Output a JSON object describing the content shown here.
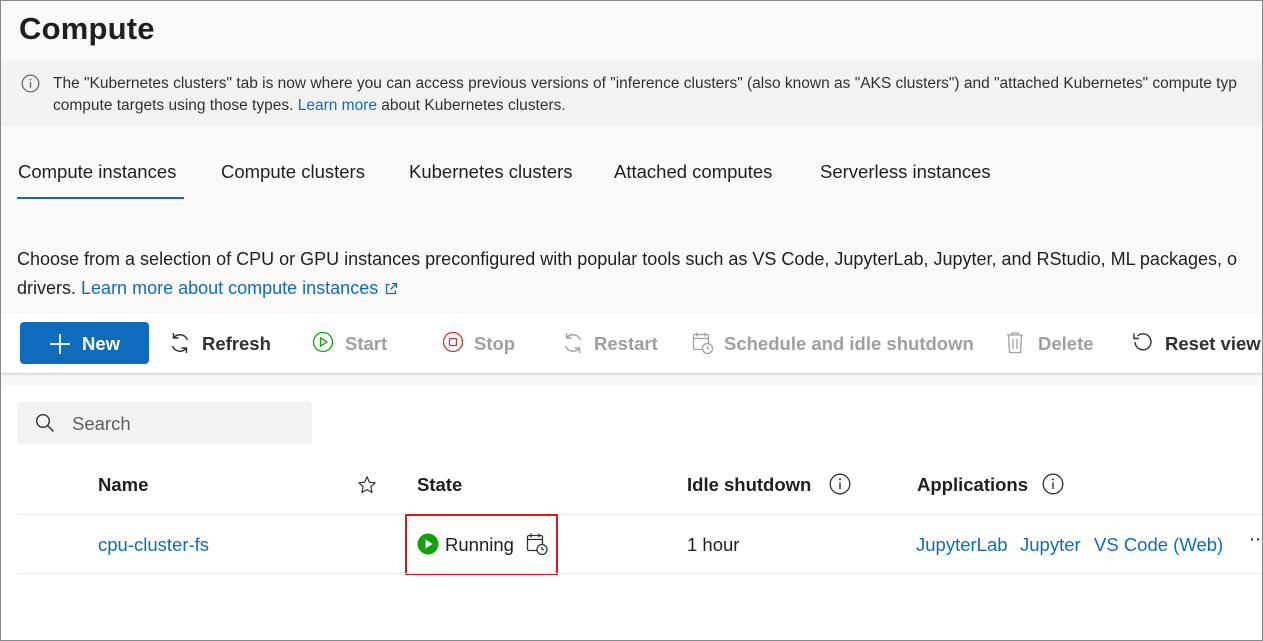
{
  "page": {
    "title": "Compute"
  },
  "info_bar": {
    "line1": "The \"Kubernetes clusters\" tab is now where you can access previous versions of \"inference clusters\" (also known as \"AKS clusters\") and \"attached Kubernetes\" compute typ",
    "line2_before": "compute targets using those types.",
    "link": "Learn more",
    "line2_after": "about Kubernetes clusters."
  },
  "tabs": [
    {
      "label": "Compute instances",
      "active": true
    },
    {
      "label": "Compute clusters",
      "active": false
    },
    {
      "label": "Kubernetes clusters",
      "active": false
    },
    {
      "label": "Attached computes",
      "active": false
    },
    {
      "label": "Serverless instances",
      "active": false
    }
  ],
  "description": {
    "line1": "Choose from a selection of CPU or GPU instances preconfigured with popular tools such as VS Code, JupyterLab, Jupyter, and RStudio, ML packages, o",
    "line2_before": "drivers.",
    "link": "Learn more about compute instances"
  },
  "toolbar": {
    "new": "New",
    "refresh": "Refresh",
    "start": "Start",
    "stop": "Stop",
    "restart": "Restart",
    "schedule": "Schedule and idle shutdown",
    "delete": "Delete",
    "reset_view": "Reset view"
  },
  "search": {
    "placeholder": "Search"
  },
  "table": {
    "headers": {
      "name": "Name",
      "state": "State",
      "idle_shutdown": "Idle shutdown",
      "applications": "Applications"
    },
    "rows": [
      {
        "name": "cpu-cluster-fs",
        "state": "Running",
        "idle_shutdown": "1 hour",
        "applications": [
          "JupyterLab",
          "Jupyter",
          "VS Code (Web)"
        ],
        "more": "⋯"
      }
    ]
  },
  "colors": {
    "accent": "#0f6cbd",
    "running_green": "#13a10e",
    "stop_red": "#d13438",
    "highlight_red": "#d7191f"
  }
}
